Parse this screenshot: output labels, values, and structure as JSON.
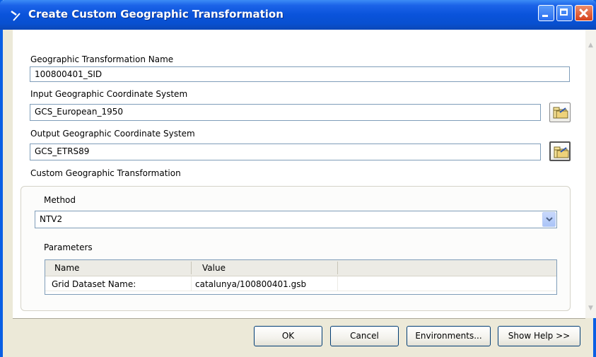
{
  "window": {
    "title": "Create Custom Geographic Transformation",
    "title_icon": "hammer-icon"
  },
  "form": {
    "name_label": "Geographic Transformation Name",
    "name_value": "100800401_SID",
    "input_gcs_label": "Input Geographic Coordinate System",
    "input_gcs_value": "GCS_European_1950",
    "output_gcs_label": "Output Geographic Coordinate System",
    "output_gcs_value": "GCS_ETRS89",
    "custom_label": "Custom Geographic Transformation"
  },
  "method": {
    "label": "Method",
    "value": "NTV2"
  },
  "parameters": {
    "label": "Parameters",
    "columns": [
      "Name",
      "Value"
    ],
    "rows": [
      {
        "name": "Grid Dataset Name:",
        "value": "catalunya/100800401.gsb"
      }
    ]
  },
  "buttons": {
    "ok": "OK",
    "cancel": "Cancel",
    "environments": "Environments...",
    "show_help": "Show Help >>"
  },
  "colors": {
    "titlebar": "#0a53db",
    "window_bg": "#ece9d8",
    "field_border": "#7f9db9"
  }
}
